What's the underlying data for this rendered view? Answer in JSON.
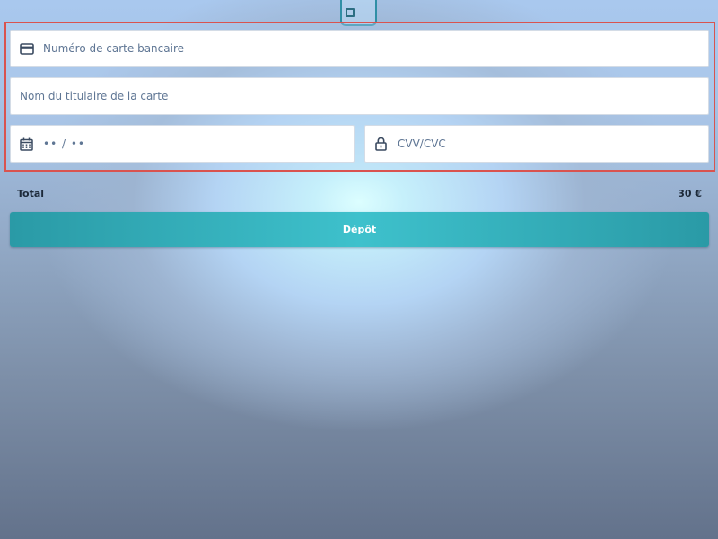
{
  "form": {
    "card_number_placeholder": "Numéro de carte bancaire",
    "card_holder_placeholder": "Nom du titulaire de la carte",
    "expiry_placeholder": "•• / ••",
    "cvv_placeholder": "CVV/CVC"
  },
  "summary": {
    "total_label": "Total",
    "total_value": "30 €"
  },
  "actions": {
    "deposit_label": "Dépôt"
  },
  "icons": {
    "card_number": "credit-card-icon",
    "expiry": "calendar-icon",
    "cvv": "padlock-icon",
    "top_handle": "card-chip-icon"
  },
  "colors": {
    "frame_border": "#d9534f",
    "button_accent": "#3ec1cc",
    "placeholder_text": "#5f7694"
  }
}
